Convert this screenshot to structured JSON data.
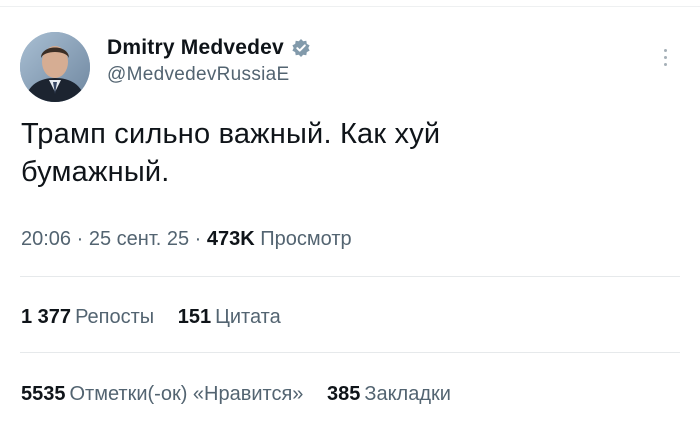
{
  "author": {
    "display_name": "Dmitry Medvedev",
    "handle": "@MedvedevRussiaE",
    "verified_icon": "verified-badge-icon",
    "avatar": "author-avatar"
  },
  "tweet": {
    "text_line1": "Трамп сильно важный. Как хуй",
    "text_line2": "бумажный."
  },
  "meta": {
    "time": "20:06",
    "sep1": " · ",
    "date": "25 сент. 25",
    "sep2": " · ",
    "views_count": "473K",
    "views_label": "Просмотр"
  },
  "stats": {
    "reposts_count": "1 377",
    "reposts_label": "Репосты",
    "quotes_count": "151",
    "quotes_label": "Цитата",
    "likes_count": "5535",
    "likes_label": "Отметки(-ок) «Нравится»",
    "bookmarks_count": "385",
    "bookmarks_label": "Закладки"
  },
  "colors": {
    "text_primary": "#0f1419",
    "text_secondary": "#536471",
    "divider": "#e6e9eb",
    "verified_badge": "#829aab"
  }
}
